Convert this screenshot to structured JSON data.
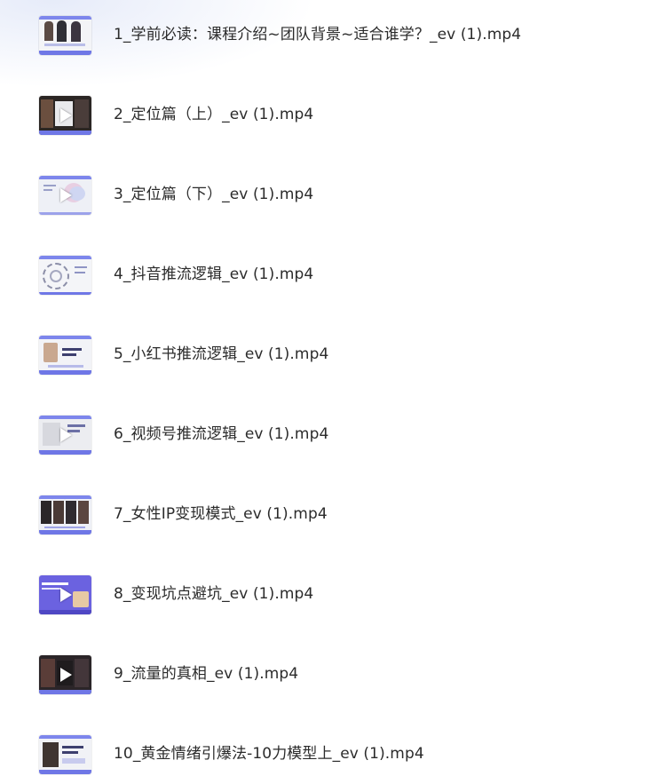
{
  "files": [
    {
      "name": "1_学前必读：课程介绍~团队背景~适合谁学？_ev (1).mp4",
      "icon": "video-thumbnail",
      "style": "people"
    },
    {
      "name": "2_定位篇（上）_ev (1).mp4",
      "icon": "video-thumbnail",
      "style": "dark-people"
    },
    {
      "name": "3_定位篇（下）_ev (1).mp4",
      "icon": "video-thumbnail",
      "style": "light-diagram"
    },
    {
      "name": "4_抖音推流逻辑_ev (1).mp4",
      "icon": "video-thumbnail",
      "style": "circle-diagram"
    },
    {
      "name": "5_小红书推流逻辑_ev (1).mp4",
      "icon": "video-thumbnail",
      "style": "slide-person"
    },
    {
      "name": "6_视频号推流逻辑_ev (1).mp4",
      "icon": "video-thumbnail",
      "style": "slide-grey"
    },
    {
      "name": "7_女性IP变现模式_ev (1).mp4",
      "icon": "video-thumbnail",
      "style": "dark-strip"
    },
    {
      "name": "8_变现坑点避坑_ev (1).mp4",
      "icon": "video-thumbnail",
      "style": "purple"
    },
    {
      "name": "9_流量的真相_ev (1).mp4",
      "icon": "video-thumbnail",
      "style": "dark-people"
    },
    {
      "name": "10_黄金情绪引爆法-10力模型上_ev (1).mp4",
      "icon": "video-thumbnail",
      "style": "slide-person"
    }
  ],
  "colors": {
    "accent": "#6f77e6",
    "text": "#2b2b2b"
  }
}
